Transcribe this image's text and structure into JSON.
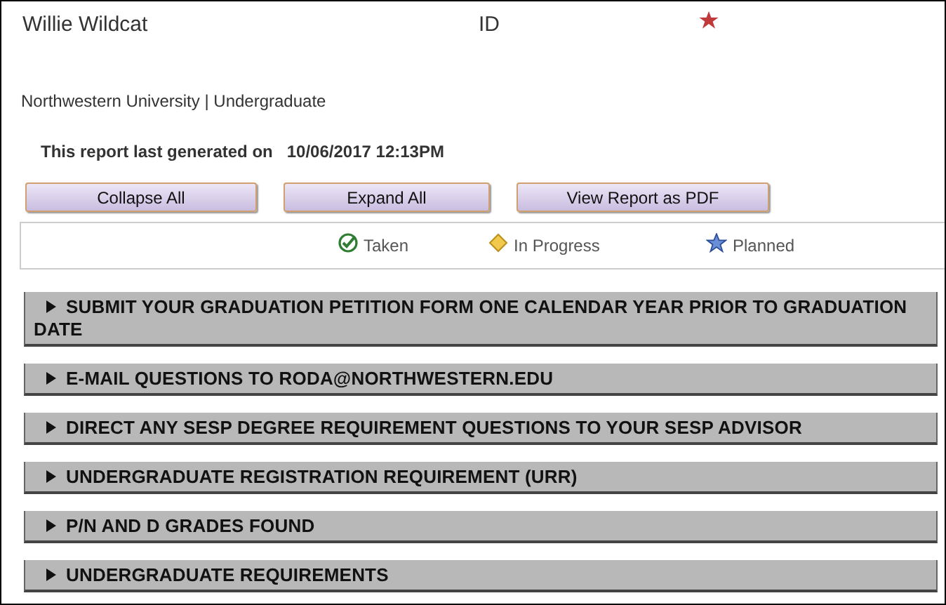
{
  "header": {
    "name": "Willie Wildcat",
    "id_label": "ID",
    "flagged": true
  },
  "program": "Northwestern University | Undergraduate",
  "report": {
    "label": "This report last generated on",
    "timestamp": "10/06/2017 12:13PM"
  },
  "buttons": [
    "Collapse All",
    "Expand All",
    "View Report as PDF"
  ],
  "legend": [
    {
      "kind": "taken",
      "label": "Taken"
    },
    {
      "kind": "in_progress",
      "label": "In Progress"
    },
    {
      "kind": "planned",
      "label": "Planned"
    }
  ],
  "sections": [
    {
      "title": "SUBMIT YOUR GRADUATION PETITION FORM ONE CALENDAR YEAR PRIOR TO GRADUATION DATE",
      "expanded": false
    },
    {
      "title": "E-MAIL QUESTIONS TO RODA@NORTHWESTERN.EDU",
      "expanded": false
    },
    {
      "title": "DIRECT ANY SESP DEGREE REQUIREMENT QUESTIONS TO YOUR SESP ADVISOR",
      "expanded": false
    },
    {
      "title": "UNDERGRADUATE REGISTRATION REQUIREMENT (URR)",
      "expanded": false
    },
    {
      "title": "P/N AND D GRADES FOUND",
      "expanded": false
    },
    {
      "title": "UNDERGRADUATE REQUIREMENTS",
      "expanded": false
    }
  ]
}
